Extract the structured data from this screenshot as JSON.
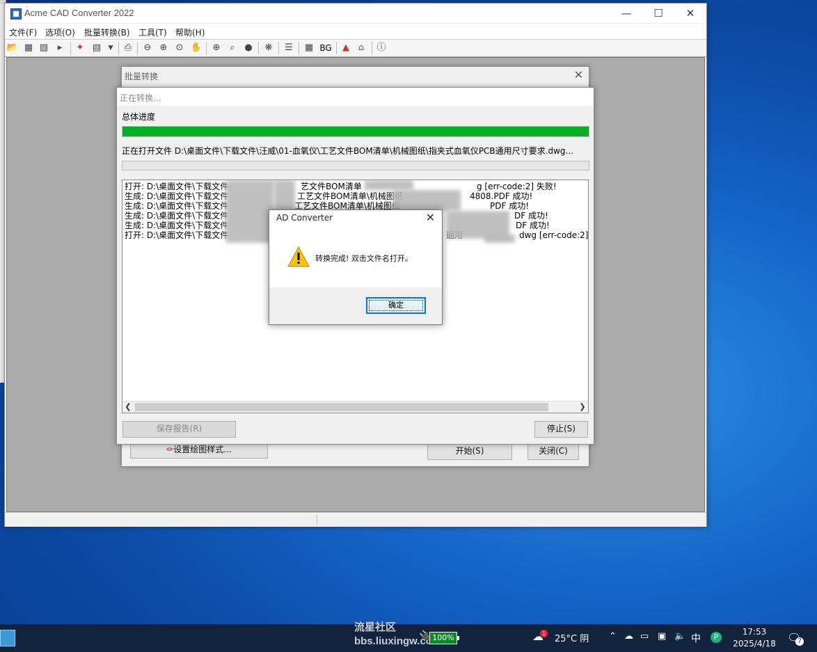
{
  "app": {
    "title": "Acme CAD Converter 2022",
    "menu": [
      "文件(F)",
      "选项(O)",
      "批量转换(B)",
      "工具(T)",
      "帮助(H)"
    ],
    "toolbar_bg_label": "BG"
  },
  "batch_dialog": {
    "title": "批量转换",
    "plot_style_button": "设置绘图样式...",
    "start_button": "开始(S)",
    "close_button": "关闭(C)"
  },
  "progress_dialog": {
    "title": "正在转换...",
    "overall_label": "总体进度",
    "overall_progress": 1.0,
    "current_file": "正在打开文件 D:\\桌面文件\\下载文件\\汪威\\01-血氧仪\\工艺文件BOM清单\\机械图纸\\指夹式血氧仪PCB通用尺寸要求.dwg...",
    "file_progress": 0.0,
    "log_lines": [
      {
        "prefix": "打开: D:\\桌面文件\\下载文件",
        "mid": "艺文件BOM清单",
        "tail": "g [err-code:2]  失败!"
      },
      {
        "prefix": "生成: D:\\桌面文件\\下载文件",
        "mid": "工艺文件BOM清单\\机械图纸",
        "tail": "4808.PDF 成功!"
      },
      {
        "prefix": "生成: D:\\桌面文件\\下载文件",
        "mid": "工艺文件BOM清单\\机械图纸",
        "tail": "PDF 成功!"
      },
      {
        "prefix": "生成: D:\\桌面文件\\下载文件",
        "mid": "",
        "tail": "DF 成功!"
      },
      {
        "prefix": "生成: D:\\桌面文件\\下载文件",
        "mid": "",
        "tail": "DF 成功!"
      },
      {
        "prefix": "打开: D:\\桌面文件\\下载文件",
        "mid": "通用",
        "tail": "dwg [err-code:2]"
      }
    ],
    "save_report_button": "保存报告(R)",
    "stop_button": "停止(S)"
  },
  "message_box": {
    "title": "AD Converter",
    "text": "转换完成! 双击文件名打开。",
    "ok_button": "确定"
  },
  "taskbar": {
    "watermark_line1": "流星社区",
    "watermark_line2": "bbs.liuxingw.com",
    "battery": "100%",
    "weather": "25°C 阴",
    "weather_badge": "1",
    "ime": "中",
    "time": "17:53",
    "date": "2025/4/18",
    "notification_count": "7"
  },
  "colors": {
    "progress_green": "#06b025",
    "desktop_blue": "#1565c8",
    "taskbar": "#12243d",
    "focus_blue": "#0078d7"
  }
}
